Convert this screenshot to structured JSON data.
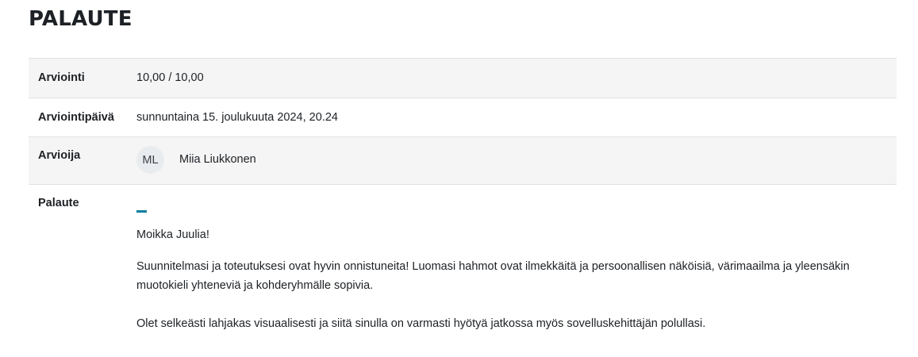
{
  "page": {
    "title": "PALAUTE"
  },
  "rows": {
    "grade": {
      "label": "Arviointi",
      "value": "10,00 / 10,00"
    },
    "graded_on": {
      "label": "Arviointipäivä",
      "value": "sunnuntaina 15. joulukuuta 2024, 20.24"
    },
    "grader": {
      "label": "Arvioija",
      "initials": "ML",
      "name": "Miia Liukkonen"
    },
    "feedback": {
      "label": "Palaute",
      "greeting": "Moikka Juulia!",
      "paragraph1": "Suunnitelmasi ja toteutuksesi ovat hyvin onnistuneita! Luomasi hahmot ovat ilmekkäitä ja persoonallisen näköisiä, värimaailma ja yleensäkin muotokieli yhteneviä ja kohderyhmälle sopivia.",
      "paragraph2": "Olet selkeästi lahjakas visuaalisesti ja siitä sinulla on varmasti hyötyä jatkossa myös sovelluskehittäjän polullasi."
    }
  },
  "colors": {
    "accent": "#0a7fa0",
    "row_shade": "#f5f5f5",
    "border": "#dee2e6",
    "avatar_bg": "#e9ecef"
  }
}
